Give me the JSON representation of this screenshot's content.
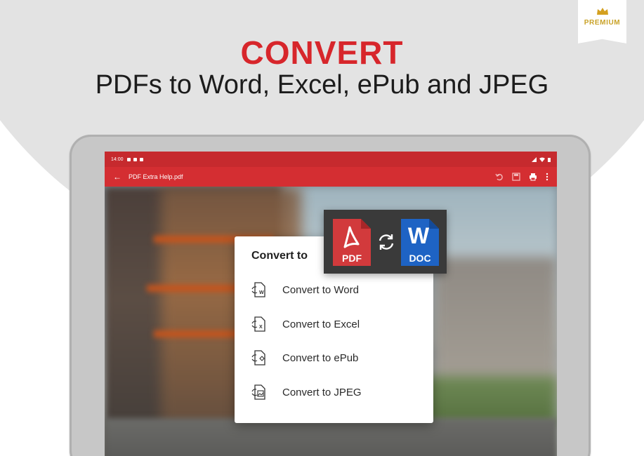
{
  "premium": {
    "label": "PREMIUM"
  },
  "hero": {
    "title": "CONVERT",
    "subtitle": "PDFs to Word, Excel, ePub and JPEG"
  },
  "status_bar": {
    "time": "14:00"
  },
  "app_bar": {
    "back_glyph": "←",
    "document_title": "PDF Extra Help.pdf"
  },
  "badge": {
    "from_label": "PDF",
    "to_label": "DOC",
    "to_letter": "W"
  },
  "dialog": {
    "title": "Convert to",
    "items": [
      {
        "label": "Convert to Word",
        "icon": "convert-word-icon",
        "letter": "W"
      },
      {
        "label": "Convert to Excel",
        "icon": "convert-excel-icon",
        "letter": "X"
      },
      {
        "label": "Convert to ePub",
        "icon": "convert-epub-icon",
        "letter": ""
      },
      {
        "label": "Convert to JPEG",
        "icon": "convert-jpeg-icon",
        "letter": ""
      }
    ]
  },
  "colors": {
    "brand_red": "#d7262b",
    "appbar_red": "#d42e32",
    "premium_gold": "#c9a227",
    "word_blue": "#1e63c4",
    "pdf_red": "#d23a3c"
  }
}
